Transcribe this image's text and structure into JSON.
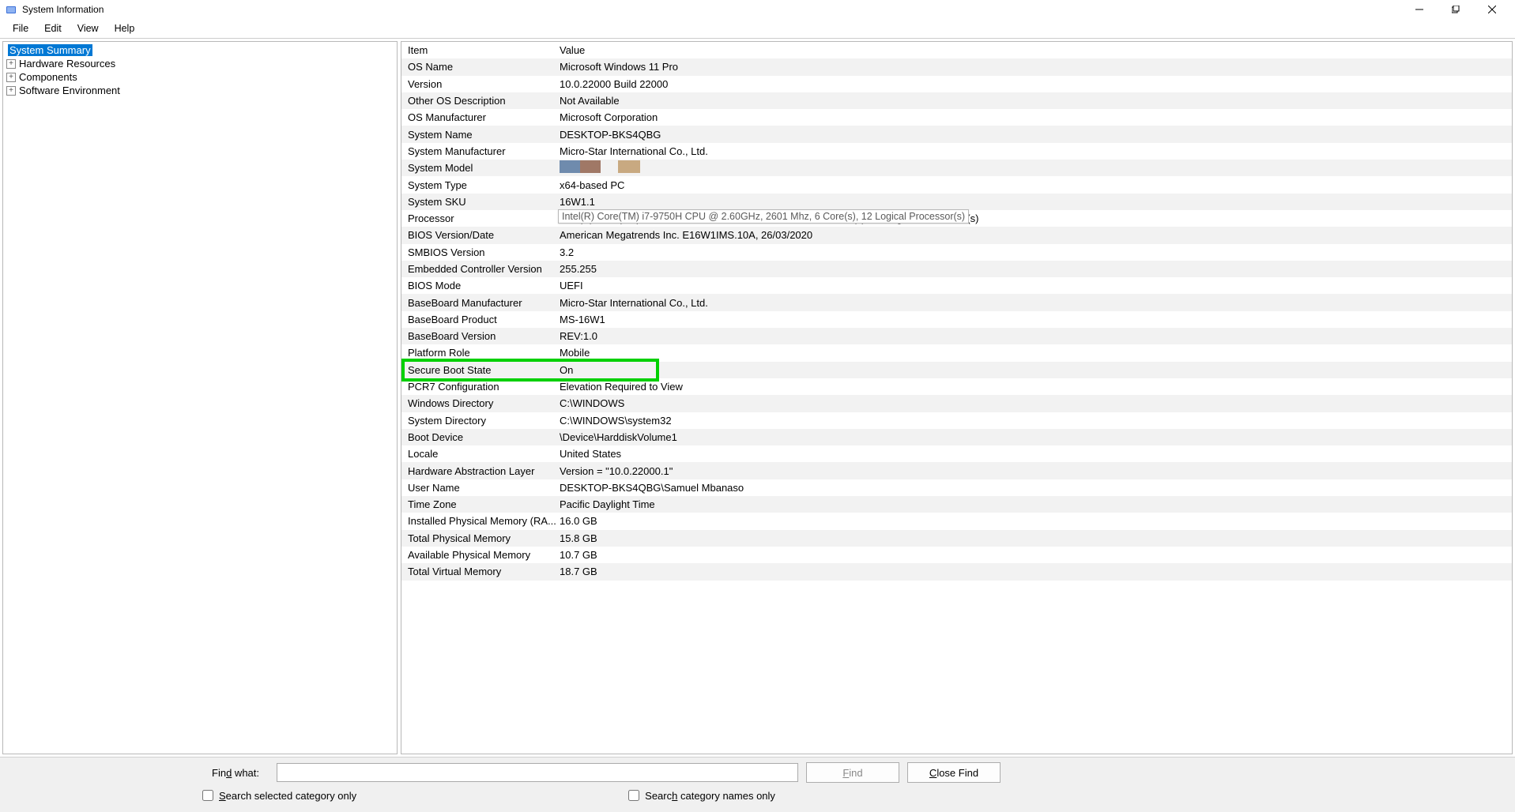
{
  "window": {
    "title": "System Information"
  },
  "menu": {
    "file": "File",
    "edit": "Edit",
    "view": "View",
    "help": "Help"
  },
  "tree": {
    "root": "System Summary",
    "children": [
      "Hardware Resources",
      "Components",
      "Software Environment"
    ]
  },
  "columns": {
    "item": "Item",
    "value": "Value"
  },
  "rows": [
    {
      "item": "OS Name",
      "value": "Microsoft Windows 11 Pro"
    },
    {
      "item": "Version",
      "value": "10.0.22000 Build 22000"
    },
    {
      "item": "Other OS Description",
      "value": "Not Available"
    },
    {
      "item": "OS Manufacturer",
      "value": "Microsoft Corporation"
    },
    {
      "item": "System Name",
      "value": "DESKTOP-BKS4QBG"
    },
    {
      "item": "System Manufacturer",
      "value": "Micro-Star International Co., Ltd."
    },
    {
      "item": "System Model",
      "value": ""
    },
    {
      "item": "System Type",
      "value": "x64-based PC"
    },
    {
      "item": "System SKU",
      "value": "16W1.1"
    },
    {
      "item": "Processor",
      "value": "Intel(R) Core(TM) i7-9750H CPU @ 2.60GHz, 2601 Mhz, 6 Core(s), 12 Logical Processor(s)"
    },
    {
      "item": "BIOS Version/Date",
      "value": "American Megatrends Inc. E16W1IMS.10A, 26/03/2020"
    },
    {
      "item": "SMBIOS Version",
      "value": "3.2"
    },
    {
      "item": "Embedded Controller Version",
      "value": "255.255"
    },
    {
      "item": "BIOS Mode",
      "value": "UEFI"
    },
    {
      "item": "BaseBoard Manufacturer",
      "value": "Micro-Star International Co., Ltd."
    },
    {
      "item": "BaseBoard Product",
      "value": "MS-16W1"
    },
    {
      "item": "BaseBoard Version",
      "value": "REV:1.0"
    },
    {
      "item": "Platform Role",
      "value": "Mobile"
    },
    {
      "item": "Secure Boot State",
      "value": "On"
    },
    {
      "item": "PCR7 Configuration",
      "value": "Elevation Required to View"
    },
    {
      "item": "Windows Directory",
      "value": "C:\\WINDOWS"
    },
    {
      "item": "System Directory",
      "value": "C:\\WINDOWS\\system32"
    },
    {
      "item": "Boot Device",
      "value": "\\Device\\HarddiskVolume1"
    },
    {
      "item": "Locale",
      "value": "United States"
    },
    {
      "item": "Hardware Abstraction Layer",
      "value": "Version = \"10.0.22000.1\""
    },
    {
      "item": "User Name",
      "value": "DESKTOP-BKS4QBG\\Samuel Mbanaso"
    },
    {
      "item": "Time Zone",
      "value": "Pacific Daylight Time"
    },
    {
      "item": "Installed Physical Memory (RA...",
      "value": "16.0 GB"
    },
    {
      "item": "Total Physical Memory",
      "value": "15.8 GB"
    },
    {
      "item": "Available Physical Memory",
      "value": "10.7 GB"
    },
    {
      "item": "Total Virtual Memory",
      "value": "18.7 GB"
    }
  ],
  "tooltip": "Intel(R) Core(TM) i7-9750H CPU @ 2.60GHz, 2601 Mhz, 6 Core(s), 12 Logical Processor(s)",
  "highlight_row_index": 18,
  "redacted_colors": [
    "#6f8bad",
    "#a07866",
    "#c8a981"
  ],
  "footer": {
    "find_label": "Find what:",
    "find_btn": "Find",
    "close_find_btn": "Close Find",
    "chk_selected": "Search selected category only",
    "chk_names": "Search category names only"
  }
}
